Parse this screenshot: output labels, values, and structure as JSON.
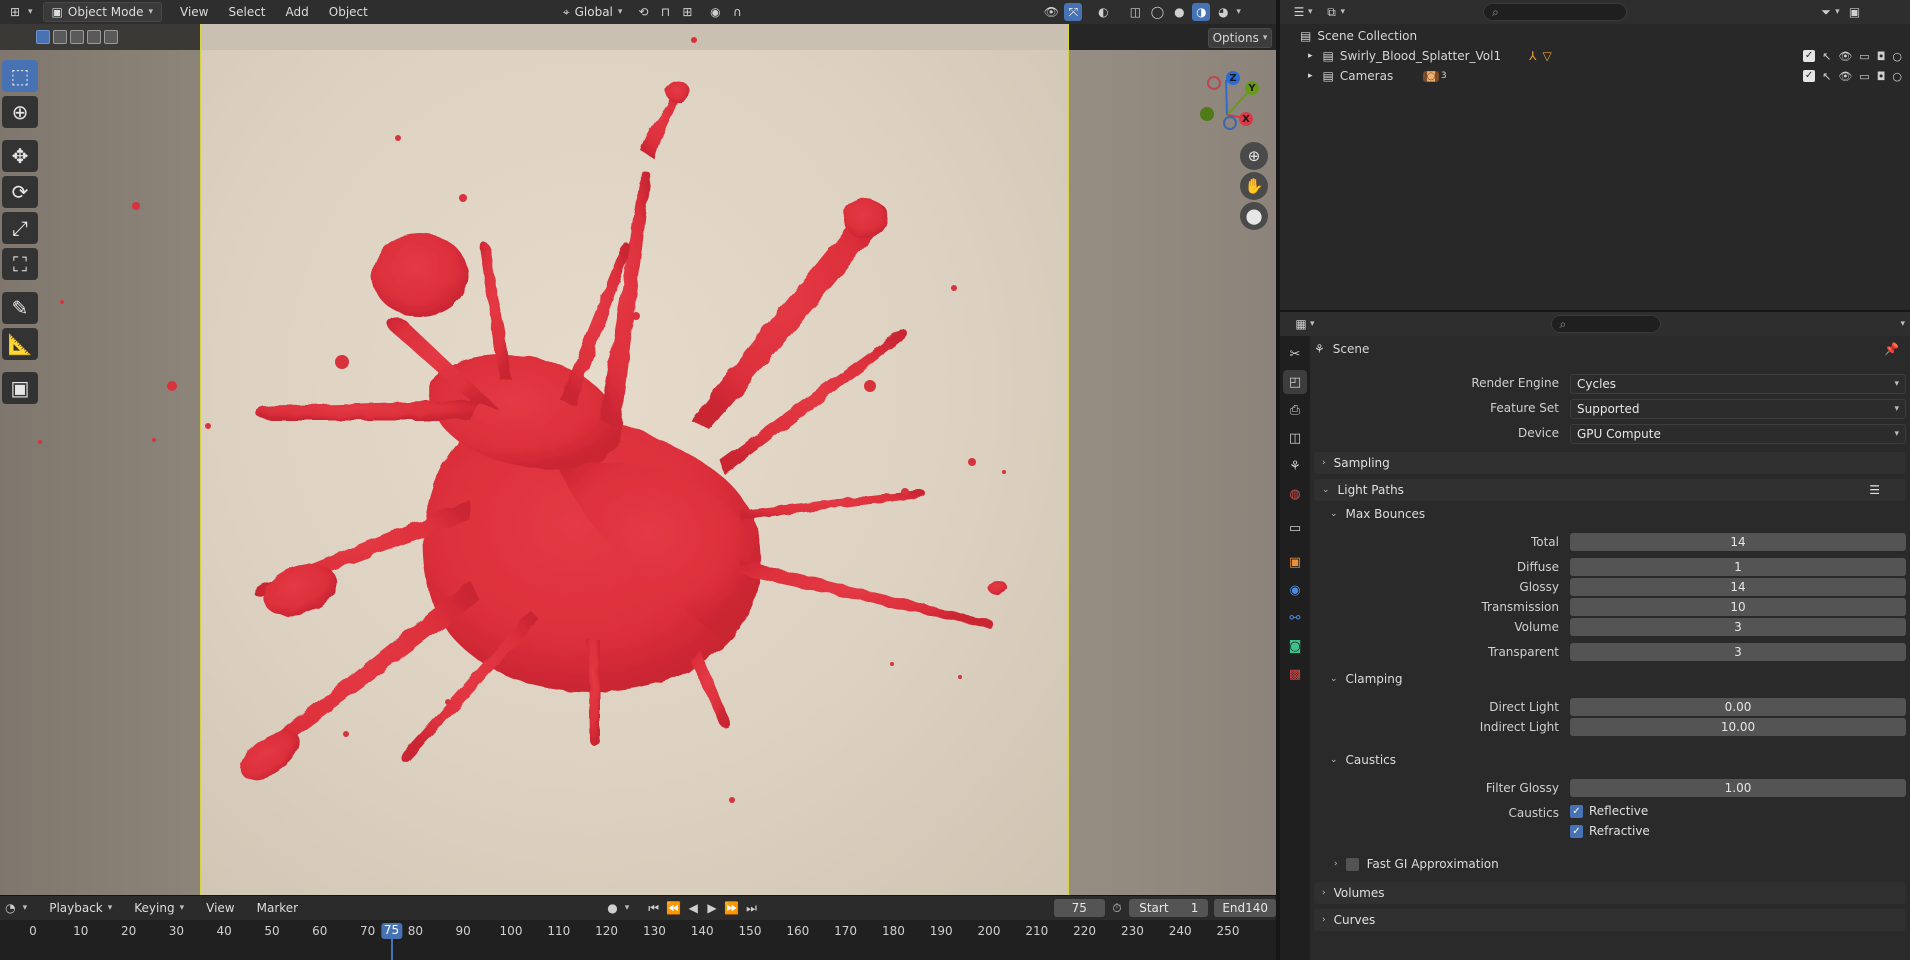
{
  "viewport": {
    "mode_label": "Object Mode",
    "menu": [
      "View",
      "Select",
      "Add",
      "Object"
    ],
    "orientation_label": "Global",
    "options_label": "Options"
  },
  "gizmo": {
    "x": "X",
    "y": "Y",
    "z": "Z"
  },
  "timeline": {
    "playback_label": "Playback",
    "keying_label": "Keying",
    "view_label": "View",
    "marker_label": "Marker",
    "current_frame": "75",
    "start_label": "Start",
    "start_value": "1",
    "end_label": "End",
    "end_value": "140",
    "ticks": [
      "0",
      "10",
      "20",
      "30",
      "40",
      "50",
      "60",
      "70",
      "80",
      "90",
      "100",
      "110",
      "120",
      "130",
      "140",
      "150",
      "160",
      "170",
      "180",
      "190",
      "200",
      "210",
      "220",
      "230",
      "240",
      "250"
    ]
  },
  "outliner": {
    "root": "Scene Collection",
    "items": [
      {
        "name": "Swirly_Blood_Splatter_Vol1"
      },
      {
        "name": "Cameras",
        "badge": "3"
      }
    ]
  },
  "properties": {
    "context_title": "Scene",
    "render_engine": {
      "label": "Render Engine",
      "value": "Cycles"
    },
    "feature_set": {
      "label": "Feature Set",
      "value": "Supported"
    },
    "device": {
      "label": "Device",
      "value": "GPU Compute"
    },
    "sampling_label": "Sampling",
    "light_paths_label": "Light Paths",
    "max_bounces_label": "Max Bounces",
    "bounces": [
      {
        "label": "Total",
        "value": "14"
      },
      {
        "label": "Diffuse",
        "value": "1"
      },
      {
        "label": "Glossy",
        "value": "14"
      },
      {
        "label": "Transmission",
        "value": "10"
      },
      {
        "label": "Volume",
        "value": "3"
      },
      {
        "label": "Transparent",
        "value": "3"
      }
    ],
    "clamping_label": "Clamping",
    "direct_light": {
      "label": "Direct Light",
      "value": "0.00"
    },
    "indirect_light": {
      "label": "Indirect Light",
      "value": "10.00"
    },
    "caustics_label": "Caustics",
    "filter_glossy": {
      "label": "Filter Glossy",
      "value": "1.00"
    },
    "caustics_row_label": "Caustics",
    "reflective_label": "Reflective",
    "refractive_label": "Refractive",
    "fast_gi_label": "Fast GI Approximation",
    "volumes_label": "Volumes",
    "curves_label": "Curves"
  },
  "colors": {
    "accent": "#4772b3",
    "splatter": "#e0303c",
    "camera_border": "#d8d440"
  }
}
